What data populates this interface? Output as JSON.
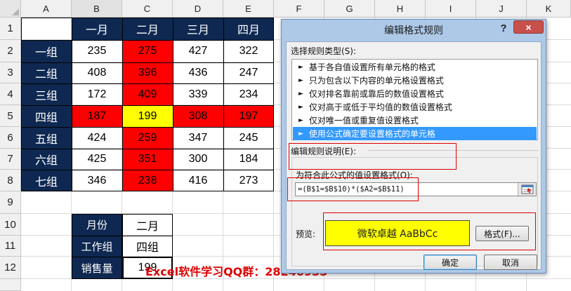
{
  "sheet": {
    "columns": [
      "A",
      "B",
      "C",
      "D",
      "E",
      "F",
      "G",
      "H",
      "I",
      "J",
      "K"
    ],
    "rows": [
      "1",
      "2",
      "3",
      "4",
      "5",
      "6",
      "7",
      "8",
      "9",
      "10",
      "11",
      "12"
    ],
    "month_headers": [
      "一月",
      "二月",
      "三月",
      "四月"
    ],
    "groups": [
      {
        "name": "一组",
        "values": [
          "235",
          "275",
          "427",
          "322"
        ]
      },
      {
        "name": "二组",
        "values": [
          "408",
          "396",
          "436",
          "247"
        ]
      },
      {
        "name": "三组",
        "values": [
          "172",
          "409",
          "339",
          "234"
        ]
      },
      {
        "name": "四组",
        "values": [
          "187",
          "199",
          "308",
          "197"
        ]
      },
      {
        "name": "五组",
        "values": [
          "424",
          "259",
          "347",
          "245"
        ]
      },
      {
        "name": "六组",
        "values": [
          "425",
          "351",
          "300",
          "184"
        ]
      },
      {
        "name": "七组",
        "values": [
          "346",
          "238",
          "416",
          "273"
        ]
      }
    ],
    "lookup": [
      {
        "label": "月份",
        "value": "二月"
      },
      {
        "label": "工作组",
        "value": "四组"
      },
      {
        "label": "销售量",
        "value": "199"
      }
    ],
    "watermark": "Excel软件学习QQ群：28246933",
    "colors": {
      "navy": "#0e2851",
      "highlight_red": "#ff0000",
      "highlight_yellow": "#ffff00"
    }
  },
  "dialog": {
    "title": "编辑格式规则",
    "help_label": "?",
    "close_label": "×",
    "rule_type_label": "选择规则类型(S):",
    "rule_types": [
      "基于各自值设置所有单元格的格式",
      "只为包含以下内容的单元格设置格式",
      "仅对排名靠前或靠后的数值设置格式",
      "仅对高于或低于平均值的数值设置格式",
      "仅对唯一值或重复值设置格式",
      "使用公式确定要设置格式的单元格"
    ],
    "selected_rule_index": 5,
    "rule_desc_label": "编辑规则说明(E):",
    "formula_label": "为符合此公式的值设置格式(O):",
    "formula": "=(B$1=$B$10)*($A2=$B$11)",
    "preview_label": "预览:",
    "preview_text": "微软卓越  AaBbCc",
    "format_button": "格式(F)...",
    "ok_button": "确定",
    "cancel_button": "取消",
    "colors": {
      "title_bar": "#aec9e8",
      "close_red": "#c7504a",
      "selection_blue": "#3399ff",
      "annotation_red": "#e00000"
    }
  }
}
